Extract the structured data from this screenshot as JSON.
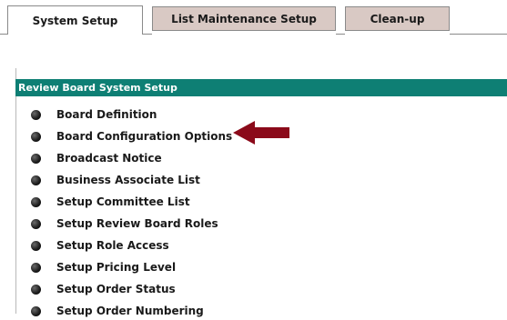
{
  "tabs": [
    {
      "label": "System Setup",
      "active": true
    },
    {
      "label": "List Maintenance Setup",
      "active": false
    },
    {
      "label": "Clean-up",
      "active": false
    }
  ],
  "panel": {
    "title": "Review Board System Setup",
    "items": [
      {
        "label": "Board Definition"
      },
      {
        "label": "Board Configuration Options"
      },
      {
        "label": "Broadcast Notice"
      },
      {
        "label": "Business Associate List"
      },
      {
        "label": "Setup Committee List"
      },
      {
        "label": "Setup Review Board Roles"
      },
      {
        "label": "Setup Role Access"
      },
      {
        "label": "Setup Pricing Level"
      },
      {
        "label": "Setup Order Status"
      },
      {
        "label": "Setup Order Numbering"
      }
    ]
  },
  "annotation": {
    "icon": "left-arrow-icon",
    "color": "#8b0a1a"
  },
  "colors": {
    "header_bg": "#0e7f74",
    "inactive_tab_bg": "#d9c9c4"
  }
}
